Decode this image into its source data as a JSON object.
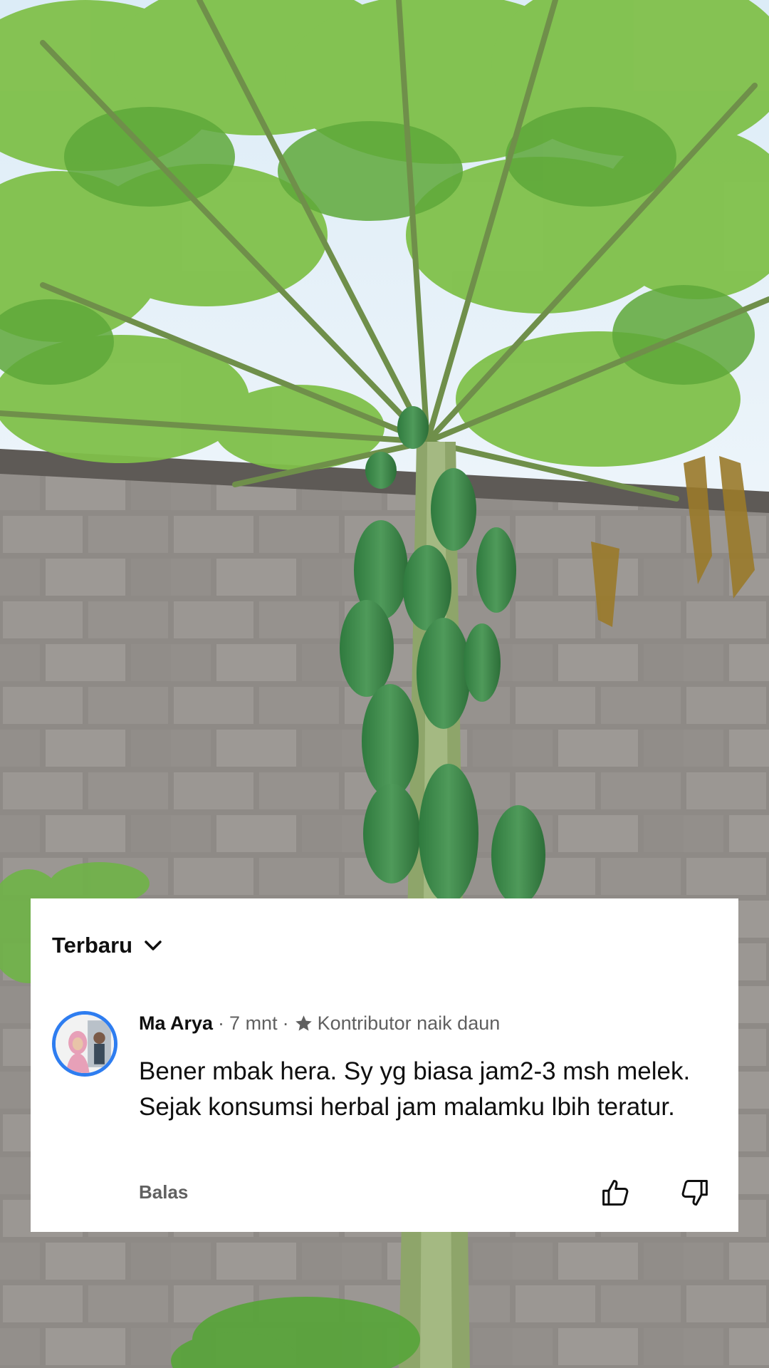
{
  "comments_panel": {
    "sort_label": "Terbaru",
    "comment": {
      "author": "Ma Arya",
      "separator_1": "·",
      "time_ago": "7 mnt",
      "separator_2": "·",
      "badge_icon": "star-icon",
      "badge_label": "Kontributor naik daun",
      "text": "Bener mbak hera. Sy yg biasa jam2-3 msh melek. Sejak konsumsi herbal jam malamku lbih teratur.",
      "reply_label": "Balas",
      "like_icon": "thumbs-up-icon",
      "dislike_icon": "thumbs-down-icon"
    }
  },
  "colors": {
    "avatar_ring": "#2e7df0",
    "card_background": "#ffffff",
    "primary_text": "#0f0f0f",
    "secondary_text": "#606060"
  }
}
